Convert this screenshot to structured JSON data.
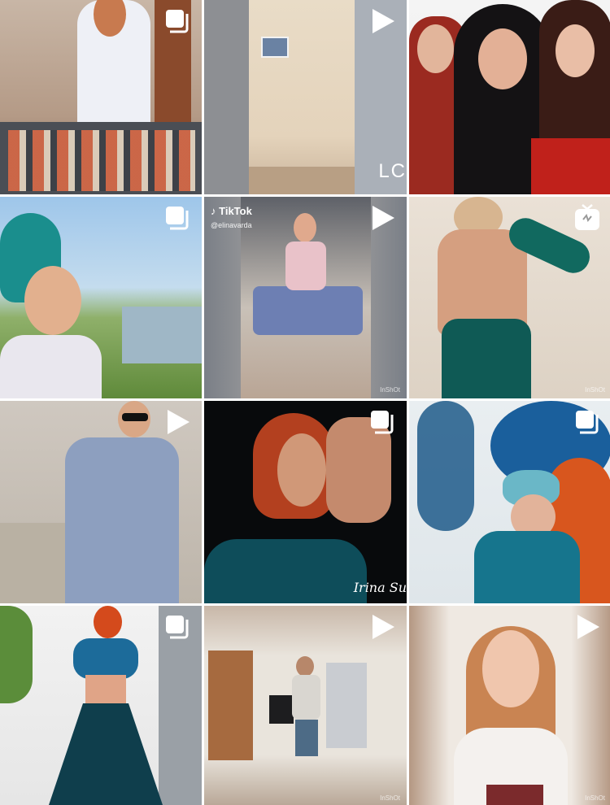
{
  "grid": {
    "posts": [
      {
        "type": "carousel",
        "icon": "carousel-icon",
        "overlay": {}
      },
      {
        "type": "video",
        "icon": "play-icon",
        "overlay": {
          "corner": "LC"
        }
      },
      {
        "type": "photo",
        "icon": "",
        "overlay": {}
      },
      {
        "type": "carousel",
        "icon": "carousel-icon",
        "overlay": {}
      },
      {
        "type": "video",
        "icon": "play-icon",
        "overlay": {
          "brand": "TikTok",
          "handle": "@elinavarda",
          "watermark": "InShOt"
        }
      },
      {
        "type": "igtv",
        "icon": "igtv-icon",
        "overlay": {
          "watermark": "InShOt"
        }
      },
      {
        "type": "video",
        "icon": "play-icon",
        "overlay": {}
      },
      {
        "type": "carousel",
        "icon": "carousel-icon",
        "overlay": {
          "signature": "Irina Su"
        }
      },
      {
        "type": "carousel",
        "icon": "carousel-icon",
        "overlay": {}
      },
      {
        "type": "carousel",
        "icon": "carousel-icon",
        "overlay": {}
      },
      {
        "type": "video",
        "icon": "play-icon",
        "overlay": {
          "watermark": "InShOt"
        }
      },
      {
        "type": "video",
        "icon": "play-icon",
        "overlay": {
          "watermark": "InShOt"
        }
      }
    ]
  }
}
